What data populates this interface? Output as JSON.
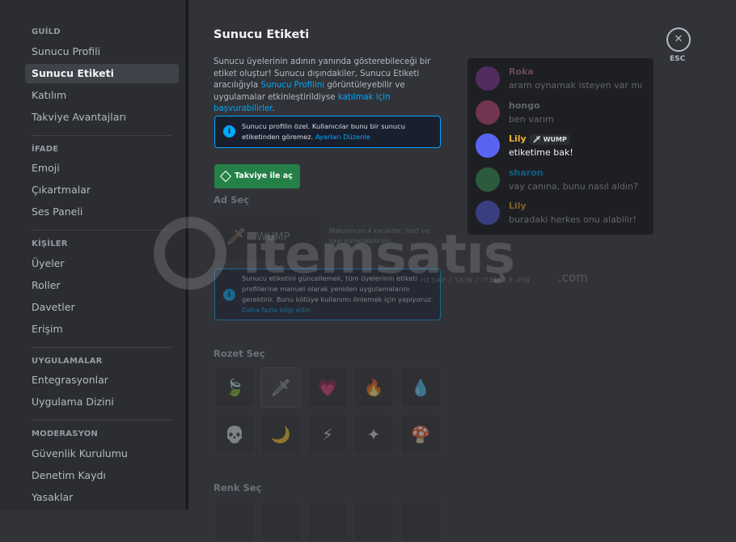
{
  "sidebar": {
    "sections": [
      {
        "title": "GUİLD",
        "items": [
          "Sunucu Profili",
          "Sunucu Etiketi",
          "Katılım",
          "Takviye Avantajları"
        ]
      },
      {
        "title": "İFADE",
        "items": [
          "Emoji",
          "Çıkartmalar",
          "Ses Paneli"
        ]
      },
      {
        "title": "KİŞİLER",
        "items": [
          "Üyeler",
          "Roller",
          "Davetler",
          "Erişim"
        ]
      },
      {
        "title": "UYGULAMALAR",
        "items": [
          "Entegrasyonlar",
          "Uygulama Dizini"
        ]
      },
      {
        "title": "MODERASYON",
        "items": [
          "Güvenlik Kurulumu",
          "Denetim Kaydı",
          "Yasaklar"
        ]
      }
    ],
    "active_item": "Sunucu Etiketi"
  },
  "main": {
    "title": "Sunucu Etiketi",
    "desc": {
      "p1": "Sunucu üyelerinin adının yanında gösterebileceği bir etiket oluştur! Sunucu dışındakiler, Sunucu Etiketi aracılığıyla ",
      "link1": "Sunucu Profilini",
      "p2": " görüntüleyebilir ve uygulamalar etkinleştirildiyse ",
      "link2": "katılmak için başvurabilirler",
      "p3": "."
    },
    "info1": {
      "text": "Sunucu profilin özel. Kullanıcılar bunu bir sunucu etiketinden göremez. ",
      "link": "Ayarları Düzenle"
    },
    "boost_button": "Takviye ile aç",
    "name_label": "Ad Seç",
    "tag_placeholder": "WUMP",
    "tag_hint": "Maksimum 4 karakter, harf ve sayı kullanabilirsin.",
    "info2": {
      "text": "Sunucu etiketini güncellemek, tüm üyelerinin etiketi profillerine manuel olarak yeniden uygulamalarını gerektirir. Bunu kötüye kullanımı önlemek için yapıyoruz. ",
      "link": "Daha fazla bilgi edin."
    },
    "badge_label": "Rozet Seç",
    "badges_row1": [
      "🍃",
      "🗡",
      "💗",
      "🔥",
      "💧"
    ],
    "badges_row2": [
      "💀",
      "🌙",
      "⚡",
      "✦",
      "🍄"
    ],
    "color_label": "Renk Seç"
  },
  "close": {
    "icon": "✕",
    "label": "ESC"
  },
  "chat": [
    {
      "name": "Roka",
      "text": "aram oynamak isteyen var mı",
      "name_color": "#c27c9e",
      "avatar_color": "#8e3fa8",
      "faded": true
    },
    {
      "name": "hongo",
      "text": "ben varım",
      "name_color": "#b5bac1",
      "avatar_color": "#d64f8a",
      "faded": true
    },
    {
      "name": "Lily",
      "text": "etiketime bak!",
      "name_color": "#f0b232",
      "avatar_color": "#5865f2",
      "faded": false,
      "tag": "WUMP",
      "tag_icon": "🗡"
    },
    {
      "name": "sharon",
      "text": "vay canına, bunu nasıl aldın?",
      "name_color": "#00a8fc",
      "avatar_color": "#3ba55c",
      "faded": true
    },
    {
      "name": "Lily",
      "text": "buradaki herkes onu alabilir!",
      "name_color": "#f0b232",
      "avatar_color": "#5865f2",
      "faded": true
    }
  ],
  "watermark": {
    "text": "itemsatış",
    "sub": "HESAP / SKIN / ITEM / E-PIN",
    "com": ".com"
  }
}
